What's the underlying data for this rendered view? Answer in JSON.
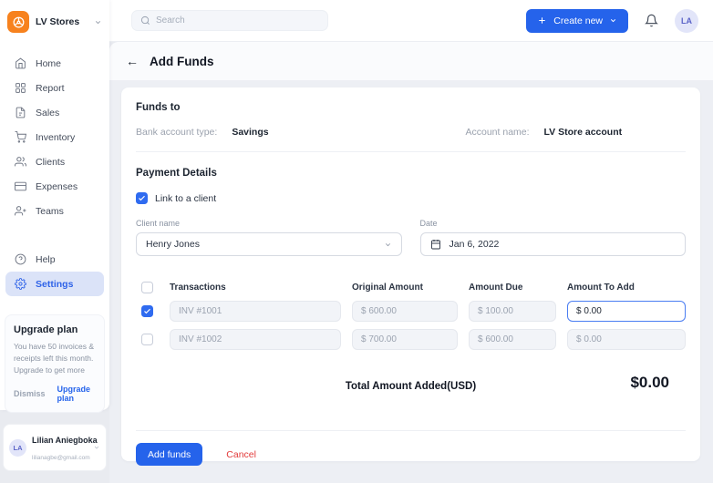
{
  "brand": {
    "name": "LV Stores"
  },
  "topbar": {
    "search_placeholder": "Search",
    "create_new_label": "Create new",
    "avatar_initials": "LA"
  },
  "sidebar": {
    "items": [
      {
        "label": "Home",
        "icon": "home-icon"
      },
      {
        "label": "Report",
        "icon": "report-icon"
      },
      {
        "label": "Sales",
        "icon": "sales-icon"
      },
      {
        "label": "Inventory",
        "icon": "inventory-icon"
      },
      {
        "label": "Clients",
        "icon": "clients-icon"
      },
      {
        "label": "Expenses",
        "icon": "expenses-icon"
      },
      {
        "label": "Teams",
        "icon": "teams-icon"
      }
    ],
    "secondary": [
      {
        "label": "Help",
        "icon": "help-icon",
        "active": false
      },
      {
        "label": "Settings",
        "icon": "settings-icon",
        "active": true
      }
    ],
    "upgrade": {
      "title": "Upgrade plan",
      "body": "You have 50 invoices & receipts left this month. Upgrade to get more",
      "dismiss_label": "Dismiss",
      "cta_label": "Upgrade plan"
    },
    "user": {
      "initials": "LA",
      "name": "Lilian Aniegboka",
      "email": "lilianagbe@gmail.com"
    }
  },
  "page": {
    "title": "Add Funds"
  },
  "funds_to": {
    "heading": "Funds to",
    "bank_account_type_label": "Bank account type:",
    "bank_account_type_value": "Savings",
    "account_name_label": "Account name:",
    "account_name_value": "LV Store account"
  },
  "payment": {
    "heading": "Payment Details",
    "link_client_label": "Link to a client",
    "link_client_checked": true,
    "client_name_label": "Client name",
    "client_name_value": "Henry Jones",
    "date_label": "Date",
    "date_value": "Jan 6, 2022"
  },
  "table": {
    "headers": [
      "Transactions",
      "Original Amount",
      "Amount Due",
      "Amount To Add"
    ],
    "rows": [
      {
        "checked": true,
        "transaction": "INV #1001",
        "original": "$ 600.00",
        "due": "$ 100.00",
        "to_add": "$ 0.00"
      },
      {
        "checked": false,
        "transaction": "INV #1002",
        "original": "$ 700.00",
        "due": "$ 600.00",
        "to_add": "$ 0.00"
      }
    ]
  },
  "total": {
    "label": "Total Amount Added(USD)",
    "value": "$0.00"
  },
  "actions": {
    "add_funds_label": "Add funds",
    "cancel_label": "Cancel"
  },
  "colors": {
    "primary_blue": "#2563eb",
    "brand_orange": "#f7821e",
    "cancel_red": "#e23b3b",
    "active_nav_bg": "#dbe3f8",
    "disabled_input_bg": "#f2f4f8",
    "active_input_border": "#4a7df2"
  }
}
